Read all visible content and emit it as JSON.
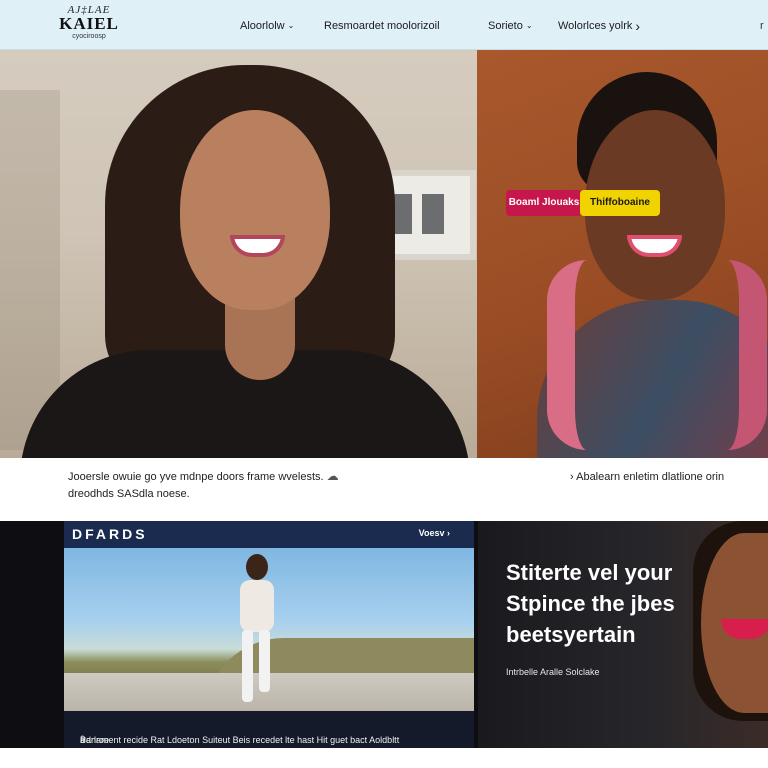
{
  "logo": {
    "line1": "AJ‡LAE",
    "line2": "KAIEL",
    "line3": "cyociroosp"
  },
  "nav": {
    "items": [
      {
        "label": "Aloorlolw",
        "chevron": "⌄"
      },
      {
        "label": "Resmoardet moolorizoil",
        "chevron": ""
      },
      {
        "label": "Sorieto",
        "chevron": "⌄"
      },
      {
        "label": "Wolorlces yolrk",
        "chevron": "›"
      }
    ],
    "edge": "r"
  },
  "caption": {
    "left_line1": "Jooersle owuie go yve mdnpe doors frame wvelests.",
    "left_line2": "dreodhds SASdla noese.",
    "cloud_icon": "☁",
    "right": "› Abalearn enletim dlatlione orin"
  },
  "feature": {
    "tag": "DFARDS",
    "more": "Voesv ›",
    "caption": "Parlament recide Rat Ldoeton Suiteut Beis recedet lte hast Hit guet bact Aoldbltt",
    "caption_icon": "å",
    "caption_end": "Bdnroe"
  },
  "promo": {
    "title": "Stiterte vel your Stpince the jbes beetsyertain",
    "subtitle": "Intrbelle Aralle Solclake",
    "primary_button": "Boaml Jlouaks",
    "secondary_button": "Thiffoboaine"
  }
}
